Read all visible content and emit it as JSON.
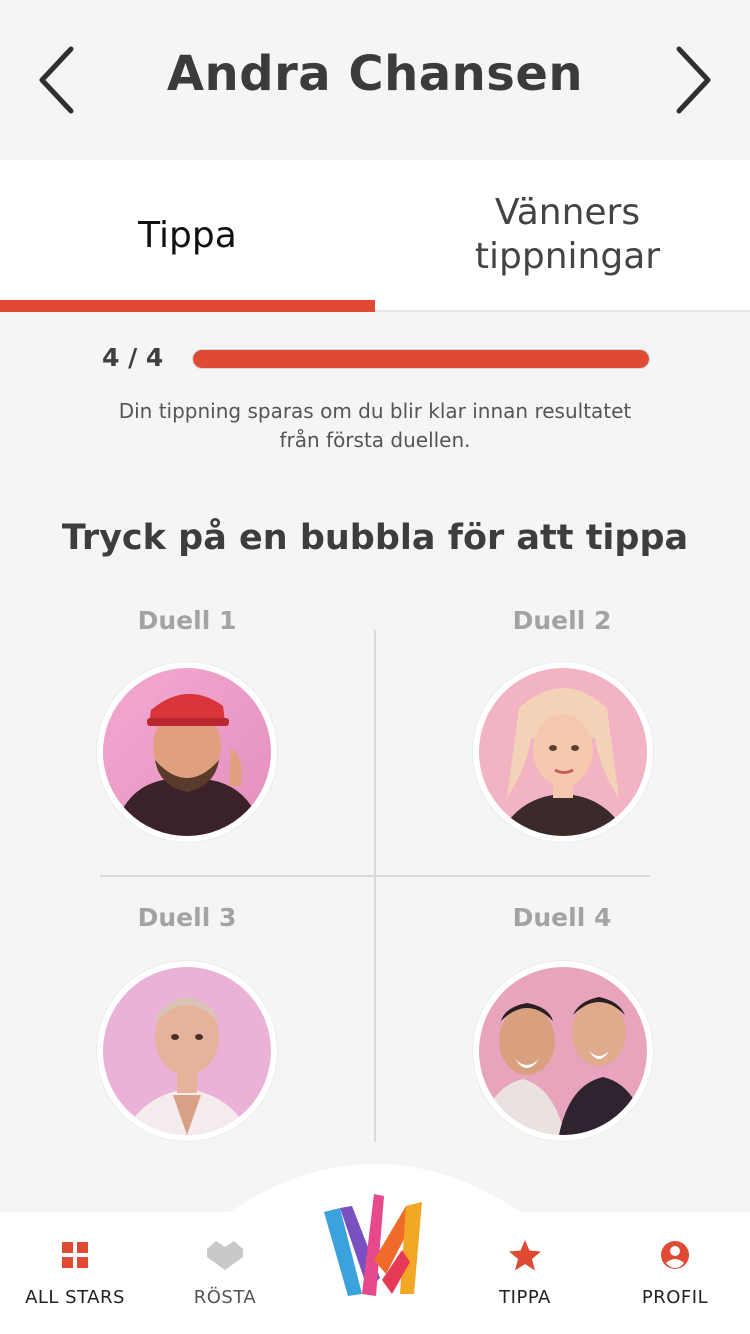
{
  "header": {
    "title": "Andra Chansen"
  },
  "tabs": [
    {
      "label": "Tippa",
      "active": true
    },
    {
      "label_line1": "Vänners",
      "label_line2": "tippningar",
      "active": false
    }
  ],
  "progress": {
    "count": "4 / 4",
    "fraction": 1.0
  },
  "info_text_line1": "Din tippning sparas om du blir klar innan resultatet",
  "info_text_line2": "från första duellen.",
  "prompt": "Tryck på en bubbla för att tippa",
  "duels": [
    {
      "label": "Duell 1"
    },
    {
      "label": "Duell 2"
    },
    {
      "label": "Duell 3"
    },
    {
      "label": "Duell 4"
    }
  ],
  "bottom_nav": [
    {
      "label": "ALL STARS",
      "icon": "grid-icon"
    },
    {
      "label": "RÖSTA",
      "icon": "heart-icon"
    },
    {
      "label": "TIPPA",
      "icon": "star-icon"
    },
    {
      "label": "PROFIL",
      "icon": "profile-icon"
    }
  ],
  "colors": {
    "accent": "#df4a32",
    "background": "#f4f5f7"
  }
}
